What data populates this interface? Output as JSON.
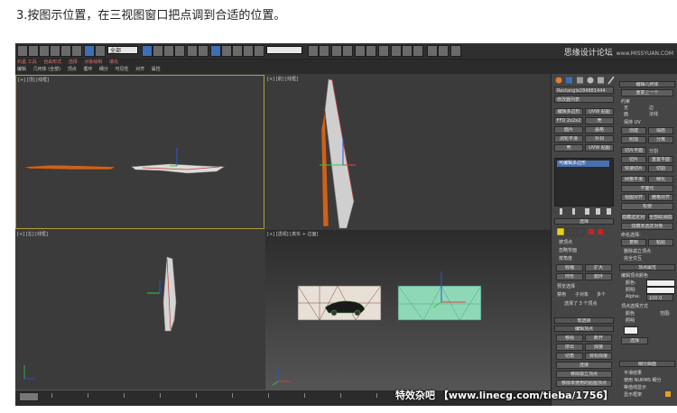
{
  "caption": "3.按图示位置，在三视图窗口把点调到合适的位置。",
  "watermark_top": {
    "site": "思缘设计论坛",
    "url": "www.MISSYUAN.COM"
  },
  "watermark_bottom": "特效杂吧 【www.linecg.com/tieba/1756】",
  "toolbar": {
    "selection_filter": "全部",
    "named_set": ""
  },
  "menubar": {
    "row1": [
      "石墨 工具",
      "自由形式",
      "选择",
      "对象绘制",
      "填充"
    ],
    "row2": [
      "编辑",
      "几何体 (全部)",
      "顶点",
      "循环",
      "细分",
      "可见性",
      "对齐",
      "属性"
    ]
  },
  "viewports": {
    "top": "[+] [顶] [线框]",
    "front": "[+] [前] [线框]",
    "left": "[+] [左] [线框]",
    "perspective": "[+] [透视] [真实 + 边面]"
  },
  "command_panel": {
    "object_name": "Rectangle284881444",
    "modifier_list": "修改器列表",
    "buttons_left": [
      "编辑多边形",
      "FFD 2x2x2",
      "面片",
      "涡轮平滑",
      "壳"
    ],
    "buttons_right": [
      "UVW 贴图",
      "壳",
      "晶格",
      "补洞",
      "UVW 贴图"
    ],
    "stack_item": "可编辑多边形",
    "selection_head": "选择",
    "by_vertex": "按顶点",
    "ignore_backfacing": "忽略背面",
    "by_angle": "按角度",
    "shrink": "收缩",
    "grow": "扩大",
    "ring": "环形",
    "loop": "循环",
    "preview_selection": "预览选择",
    "off": "禁用",
    "subobject": "子对象",
    "multi": "多个",
    "selected_count": "选择了 3 个顶点",
    "soft_selection": "软选择",
    "edit_vertices": "编辑顶点",
    "remove": "移除",
    "break": "断开",
    "extrude": "挤出",
    "weld": "焊接",
    "chamfer": "切角",
    "target_weld": "目标焊接",
    "connect": "连接",
    "remove_isolated": "移除孤立顶点",
    "remove_unused_map": "移除未使用的贴图顶点",
    "right_col": {
      "edit_geometry": "编辑几何体",
      "repeat_last": "重复上一个",
      "constraints": "约束",
      "none": "无",
      "edge": "边",
      "face": "面",
      "normal": "法线",
      "preserve_uv": "保持 UV",
      "create": "创建",
      "collapse": "塌陷",
      "attach": "附加",
      "detach": "分离",
      "slice_plane": "切片平面",
      "split": "分割",
      "slice": "切片",
      "reset_plane": "重置平面",
      "quickslice": "快速切片",
      "cut": "切割",
      "meshsmooth": "网格平滑",
      "tessellate": "细化",
      "make_planar": "平面化",
      "view_align": "视图对齐",
      "grid_align": "栅格对齐",
      "relax": "松弛",
      "hide_selected": "隐藏选定对象",
      "unhide_all": "全部取消隐藏",
      "hide_unselected": "隐藏未选定对象",
      "named_selections": "命名选择:",
      "copy": "复制",
      "paste": "粘贴",
      "delete_isolated": "删除孤立顶点",
      "full_interactivity": "完全交互",
      "vertex_properties": "顶点属性",
      "edit_vertex_color": "编辑顶点颜色",
      "color": "颜色:",
      "illumination": "照明:",
      "alpha": "Alpha:",
      "alpha_value": "100.0",
      "select_vertices_by": "顶点选择方式",
      "color_radio": "颜色",
      "illum_radio": "照明",
      "range": "范围:",
      "select": "选择",
      "subdivision_surface": "细分曲面",
      "smooth_result": "平滑结果",
      "use_nurms": "使用 NURMS 细分",
      "isoline_display": "等值线显示",
      "show_cage": "显示框架"
    }
  },
  "colors": {
    "accent_selected": "#b39b3f",
    "object_orange": "#c86420",
    "car_panel": "#e8e0d6",
    "green_panel": "#8fd8b6"
  }
}
